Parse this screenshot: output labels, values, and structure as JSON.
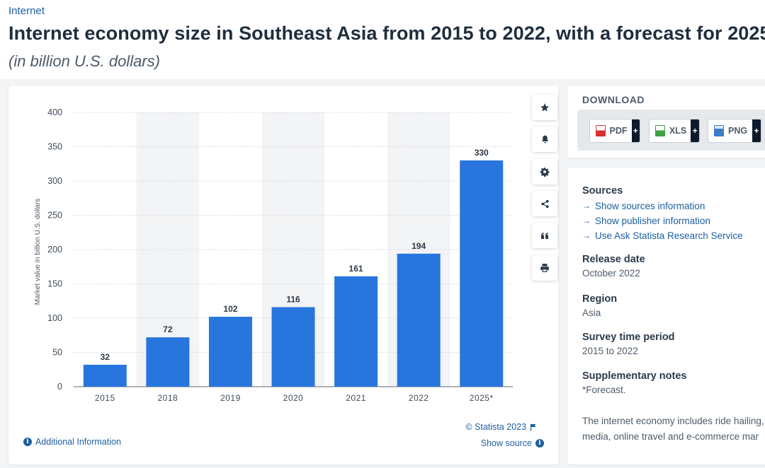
{
  "header": {
    "breadcrumb": "Internet",
    "title": "Internet economy size in Southeast Asia from 2015 to 2022, with a forecast for 2025",
    "subtitle": "(in billion U.S. dollars)"
  },
  "chart_data": {
    "type": "bar",
    "categories": [
      "2015",
      "2018",
      "2019",
      "2020",
      "2021",
      "2022",
      "2025*"
    ],
    "values": [
      32,
      72,
      102,
      116,
      161,
      194,
      330
    ],
    "ylabel": "Market value in billion U.S. dollars",
    "ylim": [
      0,
      400
    ],
    "yticks": [
      0,
      50,
      100,
      150,
      200,
      250,
      300,
      350,
      400
    ],
    "grid": true,
    "data_labels": true,
    "alternating_column_shading": true,
    "bar_color": "#2876dd"
  },
  "chart_toolbar": {
    "icons": [
      "star-icon",
      "bell-icon",
      "gear-icon",
      "share-icon",
      "quote-icon",
      "print-icon"
    ]
  },
  "chart_footer": {
    "additional_info": "Additional Information",
    "copyright": "© Statista 2023",
    "show_source": "Show source"
  },
  "download": {
    "title": "DOWNLOAD",
    "buttons": [
      {
        "label": "PDF",
        "plus": "+",
        "color": "#d9322e"
      },
      {
        "label": "XLS",
        "plus": "+",
        "color": "#3f9f44"
      },
      {
        "label": "PNG",
        "plus": "+",
        "color": "#3a7dc9"
      }
    ]
  },
  "info": {
    "sources_heading": "Sources",
    "source_links": [
      "Show sources information",
      "Show publisher information",
      "Use Ask Statista Research Service"
    ],
    "release_heading": "Release date",
    "release_value": "October 2022",
    "region_heading": "Region",
    "region_value": "Asia",
    "survey_heading": "Survey time period",
    "survey_value": "2015 to 2022",
    "notes_heading": "Supplementary notes",
    "notes_value": "*Forecast.",
    "description_line1": "The internet economy includes ride hailing,",
    "description_line2": "media, online travel and e-commerce mar"
  },
  "colors": {
    "accent": "#1d5f9f",
    "bar": "#2876dd",
    "grid": "#cfd5db",
    "shading": "#f3f4f5"
  }
}
